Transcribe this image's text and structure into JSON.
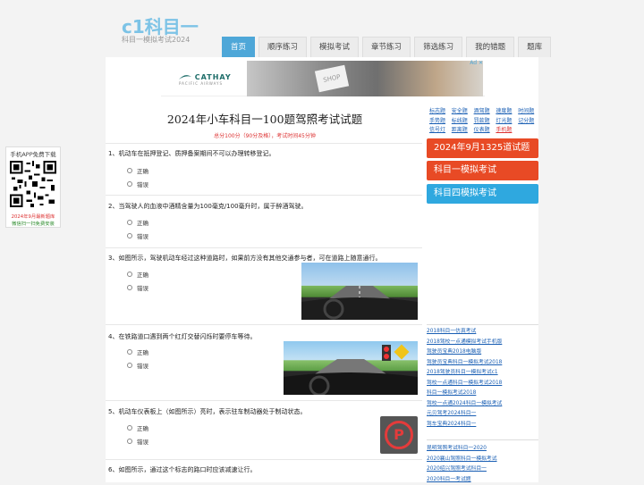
{
  "site": {
    "logo": "c1科目一",
    "tagline": "科目一模拟考试2024"
  },
  "nav": [
    {
      "label": "首页",
      "active": true
    },
    {
      "label": "顺序练习"
    },
    {
      "label": "模拟考试"
    },
    {
      "label": "章节练习"
    },
    {
      "label": "筛选练习"
    },
    {
      "label": "我的错题"
    },
    {
      "label": "题库"
    }
  ],
  "ad": {
    "brand": "CATHAY",
    "brand_sub": "PACIFIC AIRWAYS",
    "photo_text": "SHOP",
    "ad_mark": "Ad ✕"
  },
  "exam": {
    "title": "2024年小车科目一100题驾照考试试题",
    "subtitle": "总分100分（90分及格），考试时间45分钟"
  },
  "questions": [
    {
      "text": "1、机动车在抵押登记、质押备案期间不可以办理转移登记。",
      "options": [
        "正确",
        "错误"
      ]
    },
    {
      "text": "2、当驾驶人的血液中酒精含量为100毫克/100毫升时，属于醉酒驾驶。",
      "options": [
        "正确",
        "错误"
      ]
    },
    {
      "text": "3、如图所示，驾驶机动车经过这种道路时，如果前方没有其他交通参与者，可在道路上随意通行。",
      "options": [
        "正确",
        "错误"
      ]
    },
    {
      "text": "4、在铁路道口遇到两个红灯交替闪烁时要停车等待。",
      "options": [
        "正确",
        "错误"
      ]
    },
    {
      "text": "5、机动车仪表板上（如图所示）亮时，表示驻车制动器处于制动状态。",
      "options": [
        "正确",
        "错误"
      ]
    },
    {
      "text": "6、如图所示，通过这个标志的路口时应该减速让行。",
      "options": []
    }
  ],
  "brake_symbol": "P",
  "sidebar": {
    "quick_links": [
      [
        "标志题",
        "安全题",
        "酒驾题",
        "速度题",
        "时间题"
      ],
      [
        "手势题",
        "标线题",
        "罚款题",
        "灯光题",
        "记分题"
      ],
      [
        "信号灯",
        "距离题",
        "仪表题",
        "手机题"
      ]
    ],
    "buttons": [
      "2024年9月1325道试题",
      "科目一模拟考试",
      "科目四模拟考试"
    ],
    "links_a": [
      "2018科目一仿真考试",
      "2018驾校一点通模拟考试手机版",
      "驾驶员宝典2018电脑版",
      "驾驶员宝典科目一模拟考试2018",
      "2018驾驶员科目一模拟考试c1",
      "驾校一点通科目一模拟考试2018",
      "科目一模拟考试2018",
      "驾校一点通2024科目一模拟考试",
      "元贝驾考2024科目一",
      "驾车宝典2024科目一"
    ],
    "links_b": [
      "昆明驾照考试科目一2020",
      "2020襄山驾照科目一模拟考试",
      "2020绍兴驾照考试科目一",
      "2020科目一考试题"
    ]
  },
  "qr_panel": {
    "heading": "手机APP免费下载",
    "line1": "2024年9月最新题库",
    "line2": "微信扫一扫免费安装"
  },
  "colors": {
    "accent": "#4ea7d8",
    "orange": "#e84a25",
    "blue": "#2fa8df",
    "red_text": "#dd3333"
  }
}
